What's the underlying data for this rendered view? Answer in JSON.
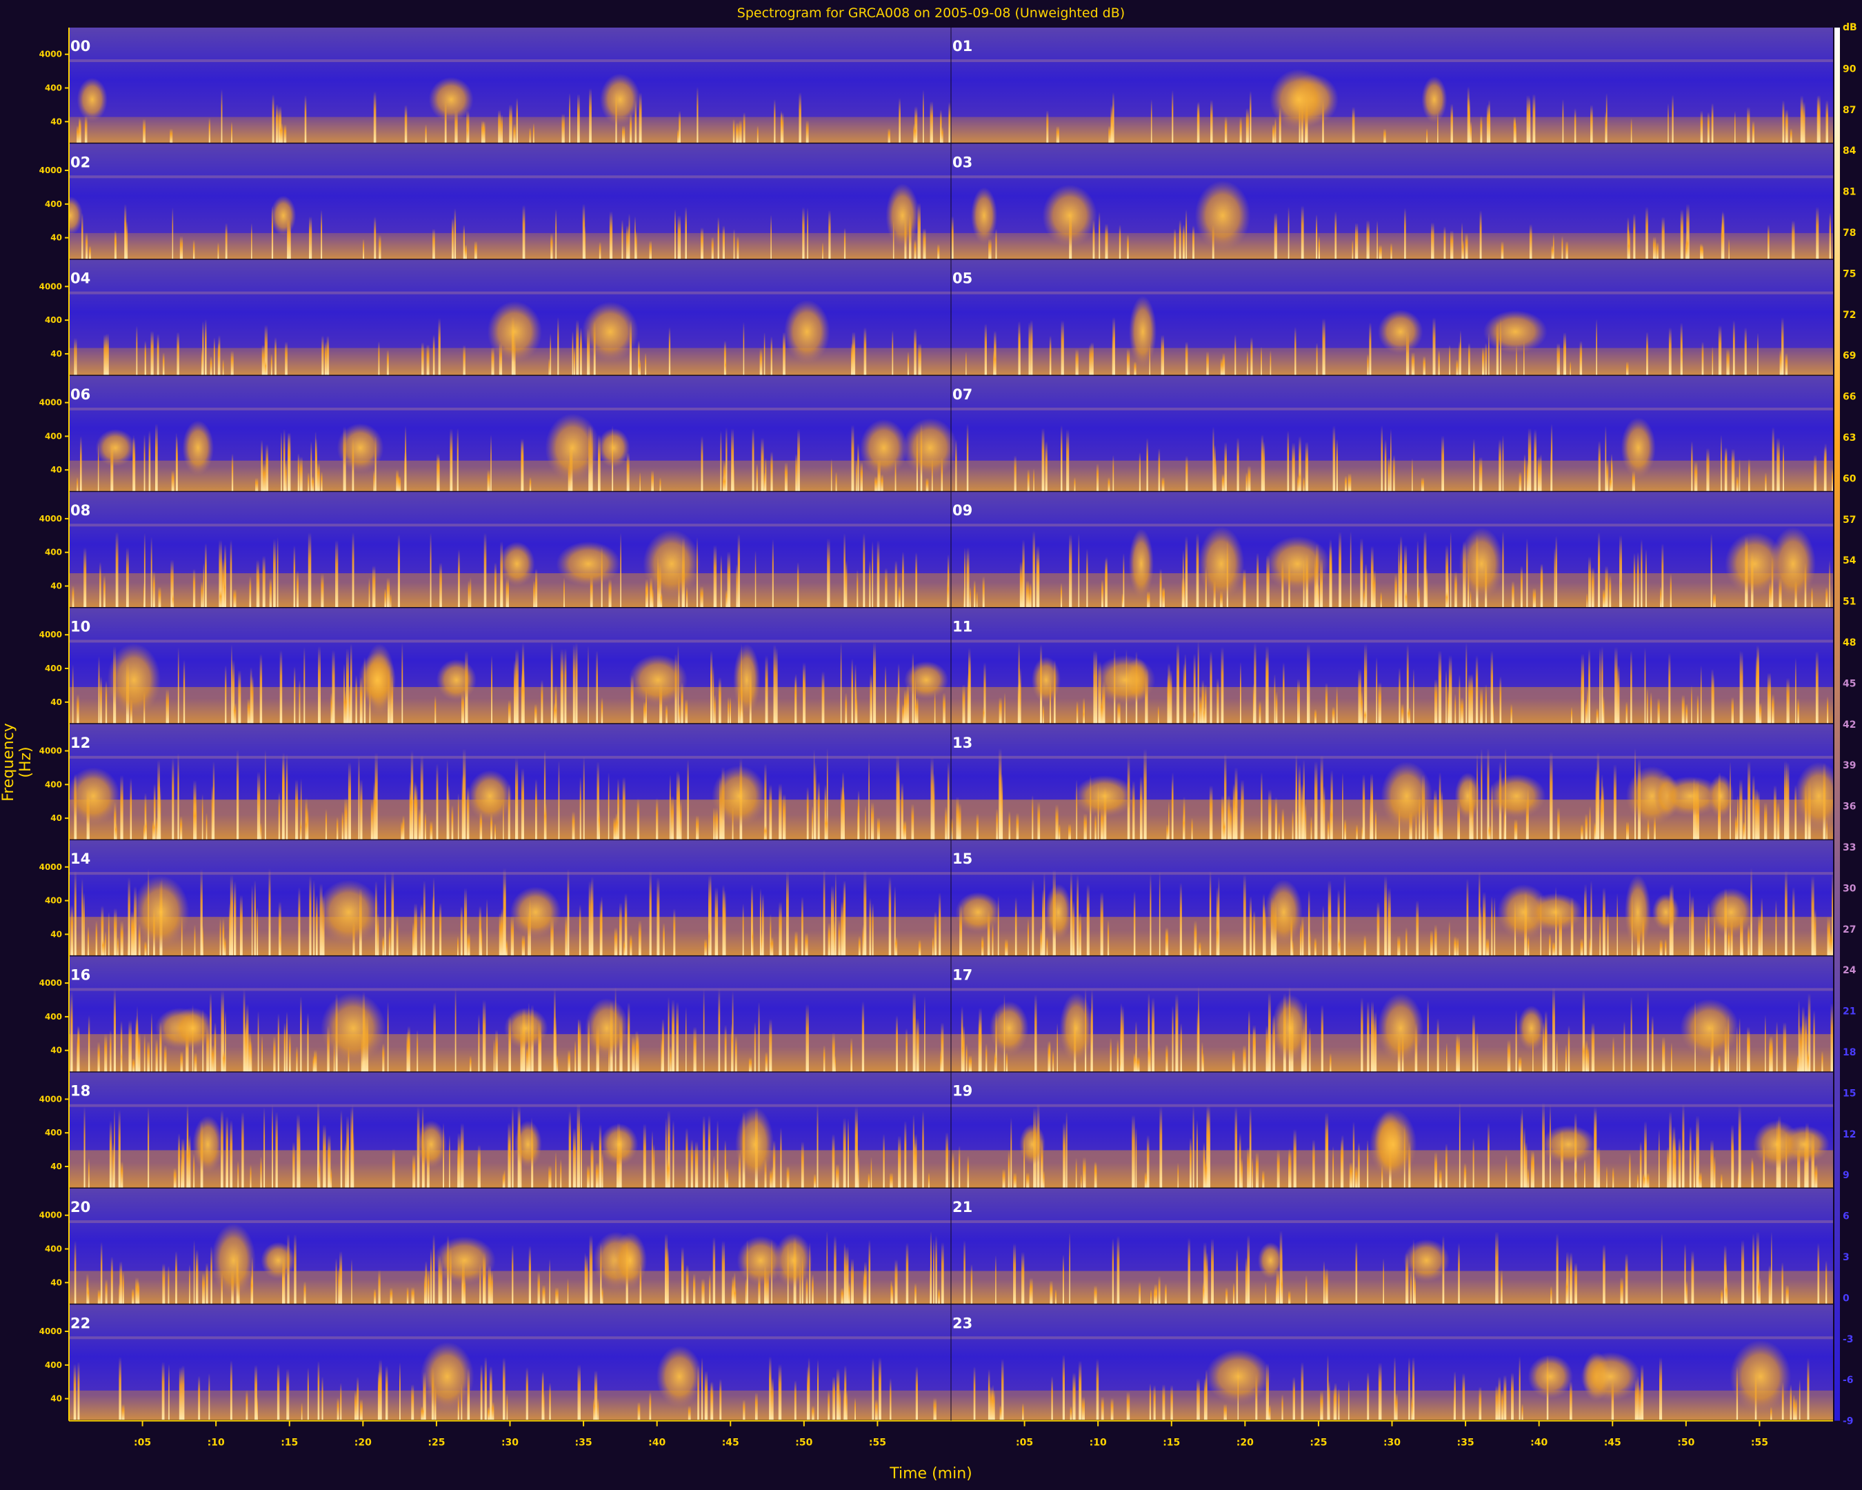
{
  "chart_data": {
    "type": "heatmap",
    "title": "Spectrogram for GRCA008 on 2005-09-08 (Unweighted dB)",
    "xlabel": "Time (min)",
    "ylabel": "Frequency (Hz)",
    "panel_columns": 2,
    "rows": [
      [
        "00",
        "01"
      ],
      [
        "02",
        "03"
      ],
      [
        "04",
        "05"
      ],
      [
        "06",
        "07"
      ],
      [
        "08",
        "09"
      ],
      [
        "10",
        "11"
      ],
      [
        "12",
        "13"
      ],
      [
        "14",
        "15"
      ],
      [
        "16",
        "17"
      ],
      [
        "18",
        "19"
      ],
      [
        "20",
        "21"
      ],
      [
        "22",
        "23"
      ]
    ],
    "frequency_ticks": [
      "4000",
      "400",
      "40"
    ],
    "time_ticks": [
      ":05",
      ":10",
      ":15",
      ":20",
      ":25",
      ":30",
      ":35",
      ":40",
      ":45",
      ":50",
      ":55"
    ],
    "colorbar": {
      "label": "dB",
      "range": [
        -9,
        93
      ],
      "ticks": [
        90,
        87,
        84,
        81,
        78,
        75,
        72,
        69,
        66,
        63,
        60,
        57,
        54,
        51,
        48,
        45,
        42,
        39,
        36,
        33,
        30,
        27,
        24,
        21,
        18,
        15,
        12,
        9,
        6,
        3,
        0,
        -3,
        -6,
        -9
      ],
      "colors": [
        "#ffffff",
        "#ffd060",
        "#ffa51e",
        "#b77a6b",
        "#5a3fb5",
        "#2a1ad8"
      ]
    },
    "activity_by_row": [
      0.25,
      0.25,
      0.3,
      0.45,
      0.6,
      0.7,
      0.85,
      0.8,
      0.75,
      0.75,
      0.55,
      0.4
    ],
    "grid": false,
    "legend": "colorbar on right"
  },
  "colors": {
    "background": "#120826",
    "axis": "#ffd400",
    "low": "#2a1ad8",
    "mid": "#5a3fb5",
    "high": "#ffa51e",
    "peak": "#ffffff"
  }
}
